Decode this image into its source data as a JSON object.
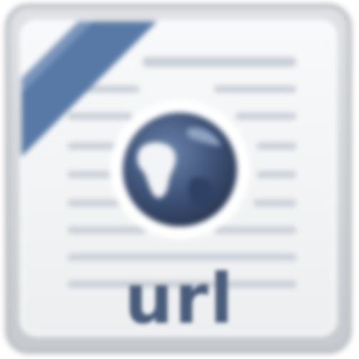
{
  "icon": {
    "name": "url-file-icon",
    "label": "url",
    "colors": {
      "frame": "#d5d7da",
      "page": "#f4f5f6",
      "ribbon": "#5879a6",
      "globe": "#3a4f74",
      "lines": "#c9cfd8",
      "label": "#4a5c7c"
    }
  }
}
